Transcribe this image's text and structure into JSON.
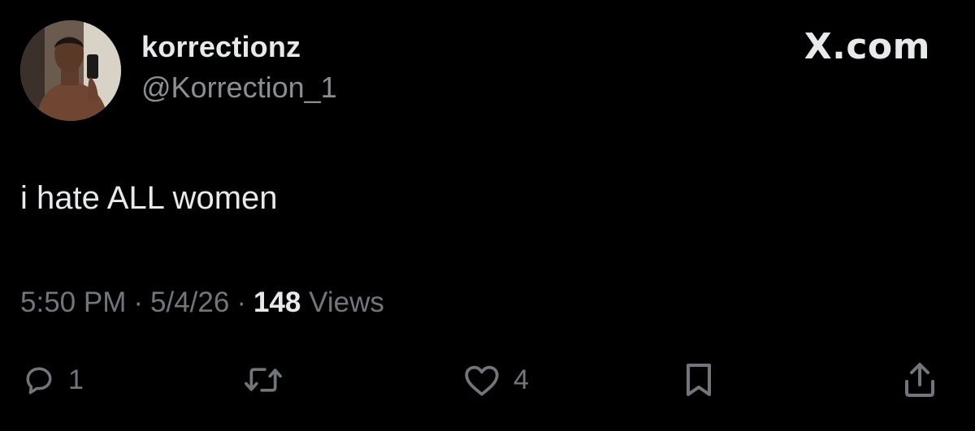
{
  "author": {
    "display_name": "korrectionz",
    "handle": "@Korrection_1",
    "avatar_icon": "profile-photo-selfie"
  },
  "brand": {
    "label": "X.com"
  },
  "tweet": {
    "text": "i hate ALL women"
  },
  "meta": {
    "time": "5:50 PM",
    "date": "5/4/26",
    "views_count": "148",
    "views_label": "Views"
  },
  "actions": {
    "reply_count": "1",
    "like_count": "4",
    "reply_icon": "speech-bubble-icon",
    "repost_icon": "repost-arrows-icon",
    "like_icon": "heart-icon",
    "bookmark_icon": "bookmark-icon",
    "share_icon": "share-upload-icon"
  },
  "colors": {
    "background": "#000000",
    "primary_text": "#e7e9ea",
    "secondary_text": "#72767b"
  }
}
